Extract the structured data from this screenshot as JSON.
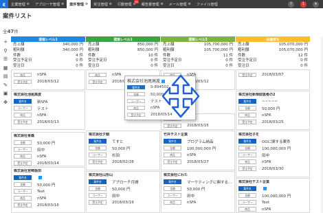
{
  "nav": {
    "tabs": [
      {
        "label": "企業管理",
        "active": false
      },
      {
        "label": "アプローチ管理",
        "active": false
      },
      {
        "label": "案件管理",
        "active": true
      },
      {
        "label": "受注管理",
        "active": false
      },
      {
        "label": "行動管理",
        "active": false,
        "badge": "28"
      },
      {
        "label": "報告書管理",
        "active": false
      },
      {
        "label": "メール管理",
        "active": false
      },
      {
        "label": "ファイル管理",
        "active": false
      }
    ],
    "notif_count": "1"
  },
  "page": {
    "title": "案件リスト",
    "count_prefix": "全",
    "count_value": "47",
    "count_suffix": "件"
  },
  "sum_labels": [
    "売上額",
    "粗利額",
    "件数",
    "受注予定日",
    "受注日"
  ],
  "chip_labels": {
    "customer": "顧客",
    "case_name": "案件名",
    "amount": "金額",
    "user": "ユーザー",
    "product": "商品",
    "order_date": "受注予定"
  },
  "columns": [
    {
      "name": "提案レベル1",
      "color": "#1e88e5",
      "sums": [
        "340,000 円",
        "340,000 円",
        "4 件",
        "0 件",
        "0 件"
      ]
    },
    {
      "name": "提案レベル2",
      "color": "#43a047",
      "sums": [
        "850,000 円",
        "850,000 円",
        "10 件",
        "0 件",
        "0 件"
      ]
    },
    {
      "name": "提案レベル3",
      "color": "#7cb342",
      "sums": [
        "105,700,000 円",
        "105,700,000 円",
        "11 件",
        "0 件",
        "0 件"
      ]
    },
    {
      "name": "決着待ち",
      "color": "#fbc02d",
      "sums": [
        "105,070,000 円",
        "105,070,000 円",
        "12 件",
        "0 件",
        "0 件"
      ]
    }
  ],
  "cards": [
    {
      "company": "",
      "rows": [
        "nSFA",
        "2018/03/12"
      ]
    },
    {
      "company": "株式会社池尾高度",
      "rows": [
        "新SFA",
        "50,000 円",
        "テスト",
        "nSFA",
        "2018/03/13"
      ]
    },
    {
      "company": "株式会社青森",
      "rows": [
        "",
        "50,000 円",
        "田中",
        "nSFA",
        "2018/03/14"
      ]
    },
    {
      "company": "株式会社宮崎坂田",
      "rows": [
        "",
        "50,000 円",
        "Text",
        "nSFA",
        "2018/03/16"
      ]
    },
    {
      "company": "",
      "rows": [
        "nSFA",
        "2018/03/12"
      ]
    },
    {
      "company": "株式会社夕顔",
      "rows": [
        "てすと",
        "50,000 円",
        "杉田",
        "nSFA",
        "2018/02/28"
      ]
    },
    {
      "company": "株式会社山形山",
      "rows": [
        "アプローチ月間",
        "50,000 円",
        "田中",
        "nSFA",
        "2018/03/19"
      ]
    },
    {
      "company": "",
      "rows": [
        "nSFA",
        "2018/03/12"
      ]
    },
    {
      "company": "",
      "rows": [
        "nSFA",
        "2018/03/15"
      ]
    },
    {
      "company": "竹井テスト企業",
      "rows": [
        "プログラム納品",
        "100,000,000 円",
        "nSFA",
        "2018/03/27"
      ]
    },
    {
      "company": "株式会社にわた",
      "rows": [
        "マーケティングに関する...",
        "50,000 円",
        "田中",
        "nSFA"
      ]
    },
    {
      "company": "",
      "rows": [
        "2018/03/07"
      ]
    },
    {
      "company": "株式会社新規取扱者の2",
      "rows": [
        "~~~~~",
        "50,000 円",
        "nSFA",
        "2018/03/25"
      ]
    },
    {
      "company": "株式会社子を",
      "rows": [
        "OOに関する案件",
        "100,000,000 円",
        "田中",
        "nSFA",
        "2018/03/30"
      ]
    },
    {
      "company": "株式会社テスト企業",
      "rows": [
        "",
        "100,000,000 円",
        "Text",
        "nSFA"
      ]
    }
  ],
  "drag": {
    "company": "株式会社池尾高度",
    "rows": [
      "S-894502",
      "50,000 円",
      "テスト",
      "nSFA",
      "2018/03/14"
    ]
  }
}
